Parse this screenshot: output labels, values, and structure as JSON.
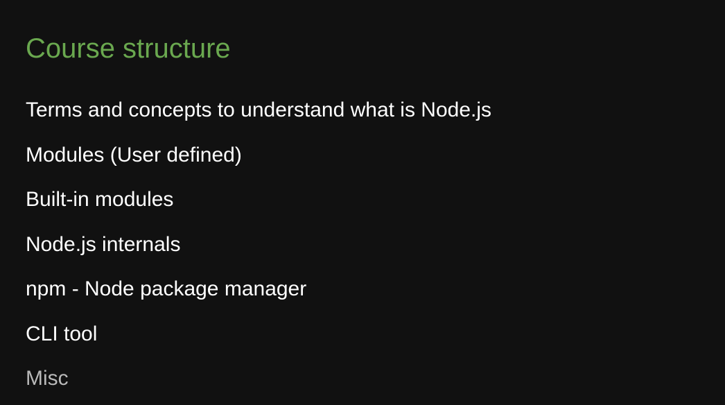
{
  "slide": {
    "title": "Course structure",
    "title_color": "#6aa84f",
    "items": [
      "Terms and concepts to understand what is Node.js",
      "Modules (User defined)",
      "Built-in modules",
      "Node.js internals",
      "npm - Node package manager",
      "CLI tool",
      "Misc"
    ]
  }
}
